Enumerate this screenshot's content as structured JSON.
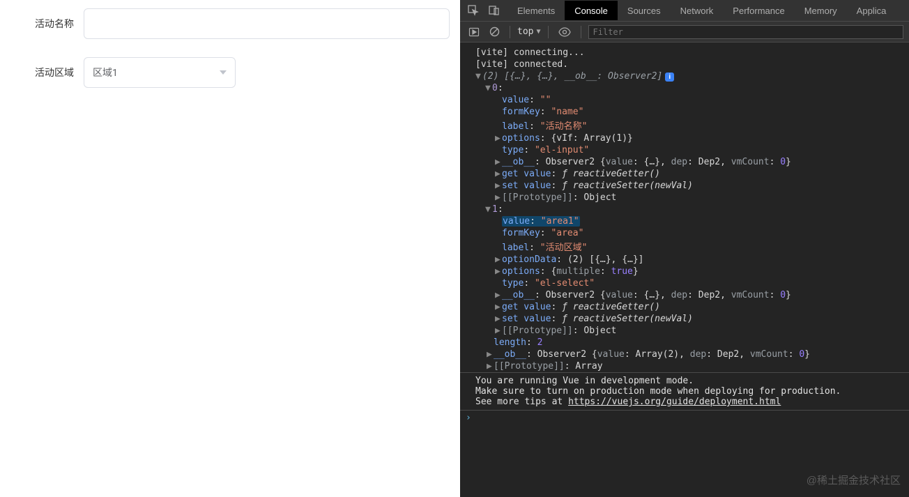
{
  "form": {
    "name_label": "活动名称",
    "name_value": "",
    "region_label": "活动区域",
    "region_selected": "区域1"
  },
  "devtools": {
    "tabs": [
      "Elements",
      "Console",
      "Sources",
      "Network",
      "Performance",
      "Memory",
      "Applica"
    ],
    "active_tab": "Console",
    "toolbar": {
      "context": "top",
      "filter_placeholder": "Filter"
    },
    "logs": {
      "l1": "[vite] connecting...",
      "l2": "[vite] connected.",
      "summary": "(2) [{…}, {…}, __ob__: Observer2]",
      "idx0": "0",
      "k_value": "value",
      "v0_value": "\"\"",
      "k_formKey": "formKey",
      "v0_formKey": "\"name\"",
      "k_label": "label",
      "v0_label": "\"活动名称\"",
      "k_options": "options",
      "v0_options": "{vIf: Array(1)}",
      "k_type": "type",
      "v0_type": "\"el-input\"",
      "k_ob": "__ob__",
      "v_ob_line": "Observer2 {value: {…}, dep: Dep2, vmCount: 0}",
      "k_getvalue": "get value",
      "v_getvalue": "ƒ reactiveGetter()",
      "k_setvalue": "set value",
      "v_setvalue": "ƒ reactiveSetter(newVal)",
      "k_proto": "[[Prototype]]",
      "v_proto_obj": "Object",
      "idx1": "1",
      "v1_value": "\"area1\"",
      "v1_formKey": "\"area\"",
      "v1_label": "\"活动区域\"",
      "k_optionData": "optionData",
      "v1_optionData": "(2) [{…}, {…}]",
      "v1_options": "{multiple: true}",
      "v1_type": "\"el-select\"",
      "k_length": "length",
      "v_length": "2",
      "v_ob_arr": "Observer2 {value: Array(2), dep: Dep2, vmCount: 0}",
      "v_proto_arr": "Array"
    },
    "footer": {
      "line1": "You are running Vue in development mode.",
      "line2": "Make sure to turn on production mode when deploying for production.",
      "line3_pre": "See more tips at ",
      "line3_link": "https://vuejs.org/guide/deployment.html"
    },
    "watermark": "@稀土掘金技术社区"
  }
}
